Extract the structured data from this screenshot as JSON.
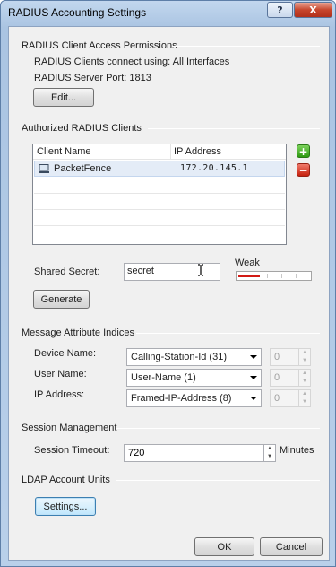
{
  "window": {
    "title": "RADIUS Accounting Settings",
    "help_label": "?",
    "close_label": "X"
  },
  "access": {
    "section_label": "RADIUS Client Access Permissions",
    "connect_text": "RADIUS Clients connect using: All Interfaces",
    "port_text": "RADIUS Server Port: 1813",
    "edit_label": "Edit..."
  },
  "clients": {
    "section_label": "Authorized RADIUS Clients",
    "columns": [
      "Client Name",
      "IP Address"
    ],
    "rows": [
      {
        "name": "PacketFence",
        "ip": "172.20.145.1",
        "icon": "computer-icon"
      }
    ],
    "add_label": "+",
    "remove_label": "−"
  },
  "secret": {
    "label": "Shared Secret:",
    "value": "secret",
    "strength_label": "Weak",
    "strength_fraction": 0.3,
    "generate_label": "Generate"
  },
  "attributes": {
    "section_label": "Message Attribute Indices",
    "rows": [
      {
        "label": "Device Name:",
        "value": "Calling-Station-Id (31)",
        "index": "0"
      },
      {
        "label": "User Name:",
        "value": "User-Name (1)",
        "index": "0"
      },
      {
        "label": "IP Address:",
        "value": "Framed-IP-Address (8)",
        "index": "0"
      }
    ]
  },
  "session": {
    "section_label": "Session Management",
    "timeout_label": "Session Timeout:",
    "timeout_value": "720",
    "timeout_unit": "Minutes"
  },
  "ldap": {
    "section_label": "LDAP Account Units",
    "settings_label": "Settings..."
  },
  "footer": {
    "ok_label": "OK",
    "cancel_label": "Cancel"
  },
  "colors": {
    "accent": "#3c7fb1",
    "strength_weak": "#d21a14",
    "add_green": "#2e9a12",
    "remove_red": "#c5200d"
  }
}
